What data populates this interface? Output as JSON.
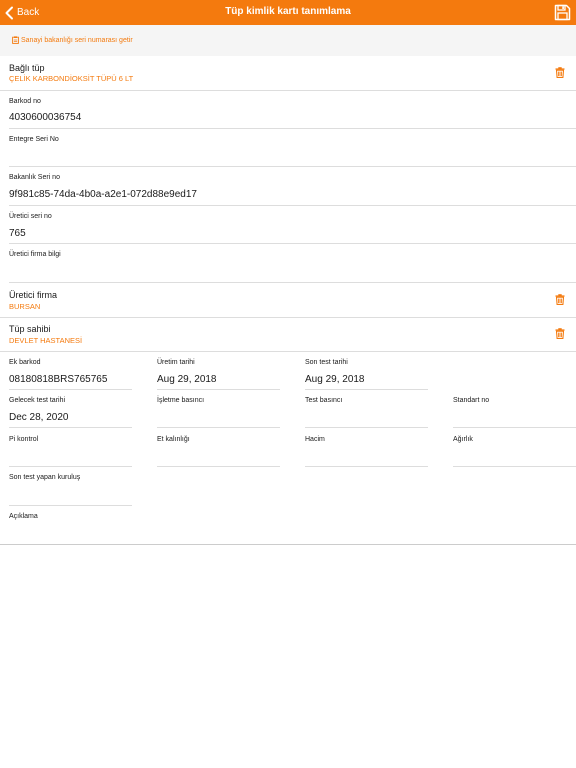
{
  "nav": {
    "back_label": "Back",
    "title": "Tüp kimlik kartı tanımlama",
    "save_icon": "save-icon"
  },
  "fetch": {
    "label": "Sanayi bakanlığı seri numarası getir"
  },
  "connected_tube": {
    "label": "Bağlı tüp",
    "value": "ÇELİK KARBONDİOKSİT TÜPÜ 6 LT"
  },
  "barcode": {
    "label": "Barkod no",
    "value": "4030600036754"
  },
  "integrated_serial": {
    "label": "Entegre Seri No",
    "value": ""
  },
  "ministry_serial": {
    "label": "Bakanlık Seri no",
    "value": "9f981c85-74da-4b0a-a2e1-072d88e9ed17"
  },
  "manufacturer_serial": {
    "label": "Üretici seri no",
    "value": "765"
  },
  "manufacturer_info": {
    "label": "Üretici firma bilgi",
    "value": ""
  },
  "manufacturer": {
    "label": "Üretici firma",
    "value": "BURSAN"
  },
  "owner": {
    "label": "Tüp sahibi",
    "value": "DEVLET HASTANESİ"
  },
  "ext_barcode": {
    "label": "Ek barkod",
    "value": "08180818BRS765765"
  },
  "production_date": {
    "label": "Üretim tarihi",
    "value": "Aug 29, 2018"
  },
  "last_test_date": {
    "label": "Son test tarihi",
    "value": "Aug 29, 2018"
  },
  "next_test_date": {
    "label": "Gelecek test tarihi",
    "value": "Dec 28, 2020"
  },
  "working_pressure": {
    "label": "İşletme basıncı",
    "value": ""
  },
  "test_pressure": {
    "label": "Test basıncı",
    "value": ""
  },
  "standard_no": {
    "label": "Standart no",
    "value": ""
  },
  "pi_control": {
    "label": "Pi kontrol",
    "value": ""
  },
  "wall_thickness": {
    "label": "Et kalınlığı",
    "value": ""
  },
  "volume": {
    "label": "Hacim",
    "value": ""
  },
  "weight": {
    "label": "Ağırlık",
    "value": ""
  },
  "last_test_org": {
    "label": "Son test yapan kuruluş",
    "value": ""
  },
  "description": {
    "label": "Açıklama",
    "value": ""
  },
  "colors": {
    "accent": "#f47a0e",
    "divider": "#dddddd"
  }
}
